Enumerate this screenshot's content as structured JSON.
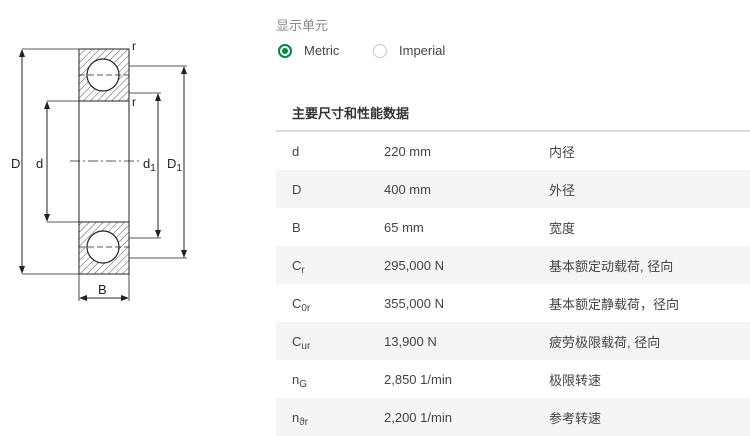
{
  "diagram": {
    "label_r_top": "r",
    "label_r_mid": "r",
    "label_D": "D",
    "label_d": "d",
    "label_d1_main": "d",
    "label_d1_sub": "1",
    "label_D1_main": "D",
    "label_D1_sub": "1",
    "label_B": "B"
  },
  "units": {
    "label": "显示单元",
    "options": [
      {
        "label": "Metric",
        "selected": true
      },
      {
        "label": "Imperial",
        "selected": false
      }
    ]
  },
  "section_title": "主要尺寸和性能数据",
  "rows": [
    {
      "sym": "d",
      "sub": "",
      "value": "220 mm",
      "desc": "内径"
    },
    {
      "sym": "D",
      "sub": "",
      "value": "400 mm",
      "desc": "外径"
    },
    {
      "sym": "B",
      "sub": "",
      "value": "65 mm",
      "desc": "宽度"
    },
    {
      "sym": "C",
      "sub": "r",
      "value": "295,000 N",
      "desc": "基本额定动载荷, 径向"
    },
    {
      "sym": "C",
      "sub": "0r",
      "value": "355,000 N",
      "desc": "基本额定静载荷，径向"
    },
    {
      "sym": "C",
      "sub": "ur",
      "value": "13,900 N",
      "desc": "疲劳极限载荷, 径向"
    },
    {
      "sym": "n",
      "sub": "G",
      "value": "2,850 1/min",
      "desc": "极限转速"
    },
    {
      "sym": "n",
      "sub": "ϑr",
      "value": "2,200 1/min",
      "desc": "参考转速"
    }
  ]
}
